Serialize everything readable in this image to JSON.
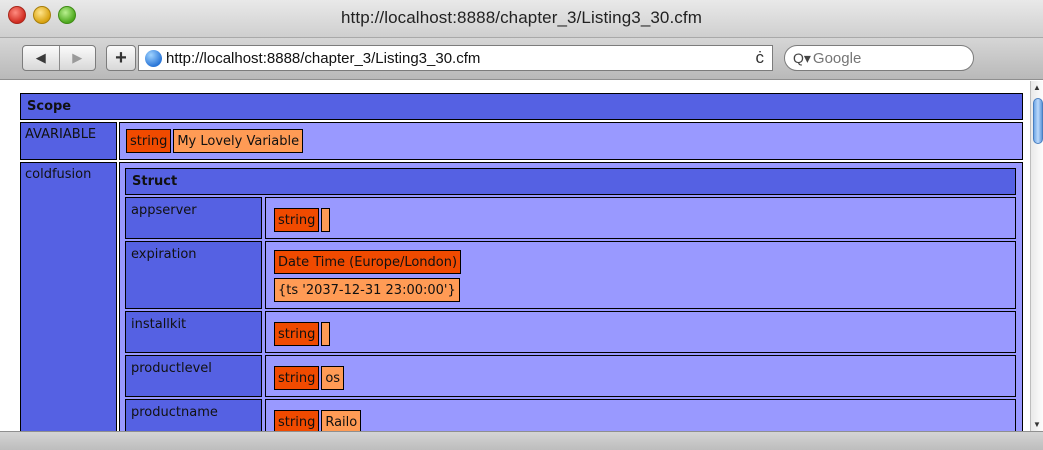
{
  "window": {
    "title": "http://localhost:8888/chapter_3/Listing3_30.cfm"
  },
  "toolbar": {
    "back_glyph": "◀",
    "forward_glyph": "▶",
    "add_glyph": "+",
    "url": "http://localhost:8888/chapter_3/Listing3_30.cfm",
    "reload_glyph": "ċ",
    "search_glyph": "Q▾",
    "search_placeholder": "Google"
  },
  "dump": {
    "heading": "Scope",
    "avariable": {
      "key": "AVARIABLE",
      "type": "string",
      "value": "My Lovely Variable"
    },
    "coldfusion": {
      "key": "coldfusion",
      "struct_heading": "Struct",
      "appserver": {
        "key": "appserver",
        "type": "string",
        "value": ""
      },
      "expiration": {
        "key": "expiration",
        "type": "Date Time (Europe/London)",
        "value": "{ts '2037-12-31 23:00:00'}"
      },
      "installkit": {
        "key": "installkit",
        "type": "string",
        "value": ""
      },
      "productlevel": {
        "key": "productlevel",
        "type": "string",
        "value": "os"
      },
      "productname": {
        "key": "productname",
        "type": "string",
        "value": "Railo"
      }
    }
  },
  "icons": [
    "close-icon",
    "minimize-icon",
    "zoom-icon",
    "back-icon",
    "forward-icon",
    "add-bookmark-icon",
    "globe-icon",
    "reload-icon",
    "search-icon",
    "scroll-up-icon",
    "scroll-down-icon"
  ],
  "colors": {
    "header_blue": "#5561e3",
    "value_lavender": "#9999ff",
    "type_orange": "#f04a00",
    "value_orange": "#ff9b55"
  }
}
